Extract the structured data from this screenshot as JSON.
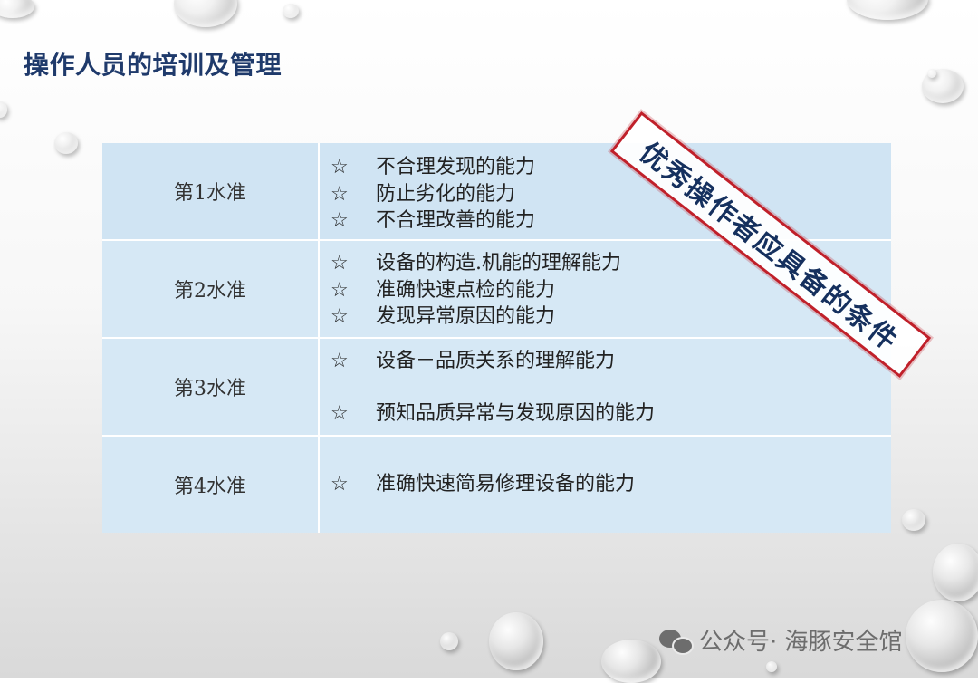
{
  "title": "操作人员的培训及管理",
  "stamp": "优秀操作者应具备的条件",
  "levels": [
    {
      "label": "第1水准",
      "items": [
        "不合理发现的能力",
        "防止劣化的能力",
        "不合理改善的能力"
      ]
    },
    {
      "label": "第2水准",
      "items": [
        "设备的构造.机能的理解能力",
        "准确快速点检的能力",
        "发现异常原因的能力"
      ]
    },
    {
      "label": "第3水准",
      "items": [
        "设备－品质关系的理解能力",
        "预知品质异常与发现原因的能力"
      ]
    },
    {
      "label": "第4水准",
      "items": [
        "准确快速简易修理设备的能力"
      ]
    }
  ],
  "star_symbol": "☆",
  "watermark": "公众号· 海豚安全馆",
  "colors": {
    "title": "#1f3a6b",
    "cell_bg": "#d6e8f5",
    "stamp_border": "#c0202a",
    "stamp_text": "#15305e"
  }
}
